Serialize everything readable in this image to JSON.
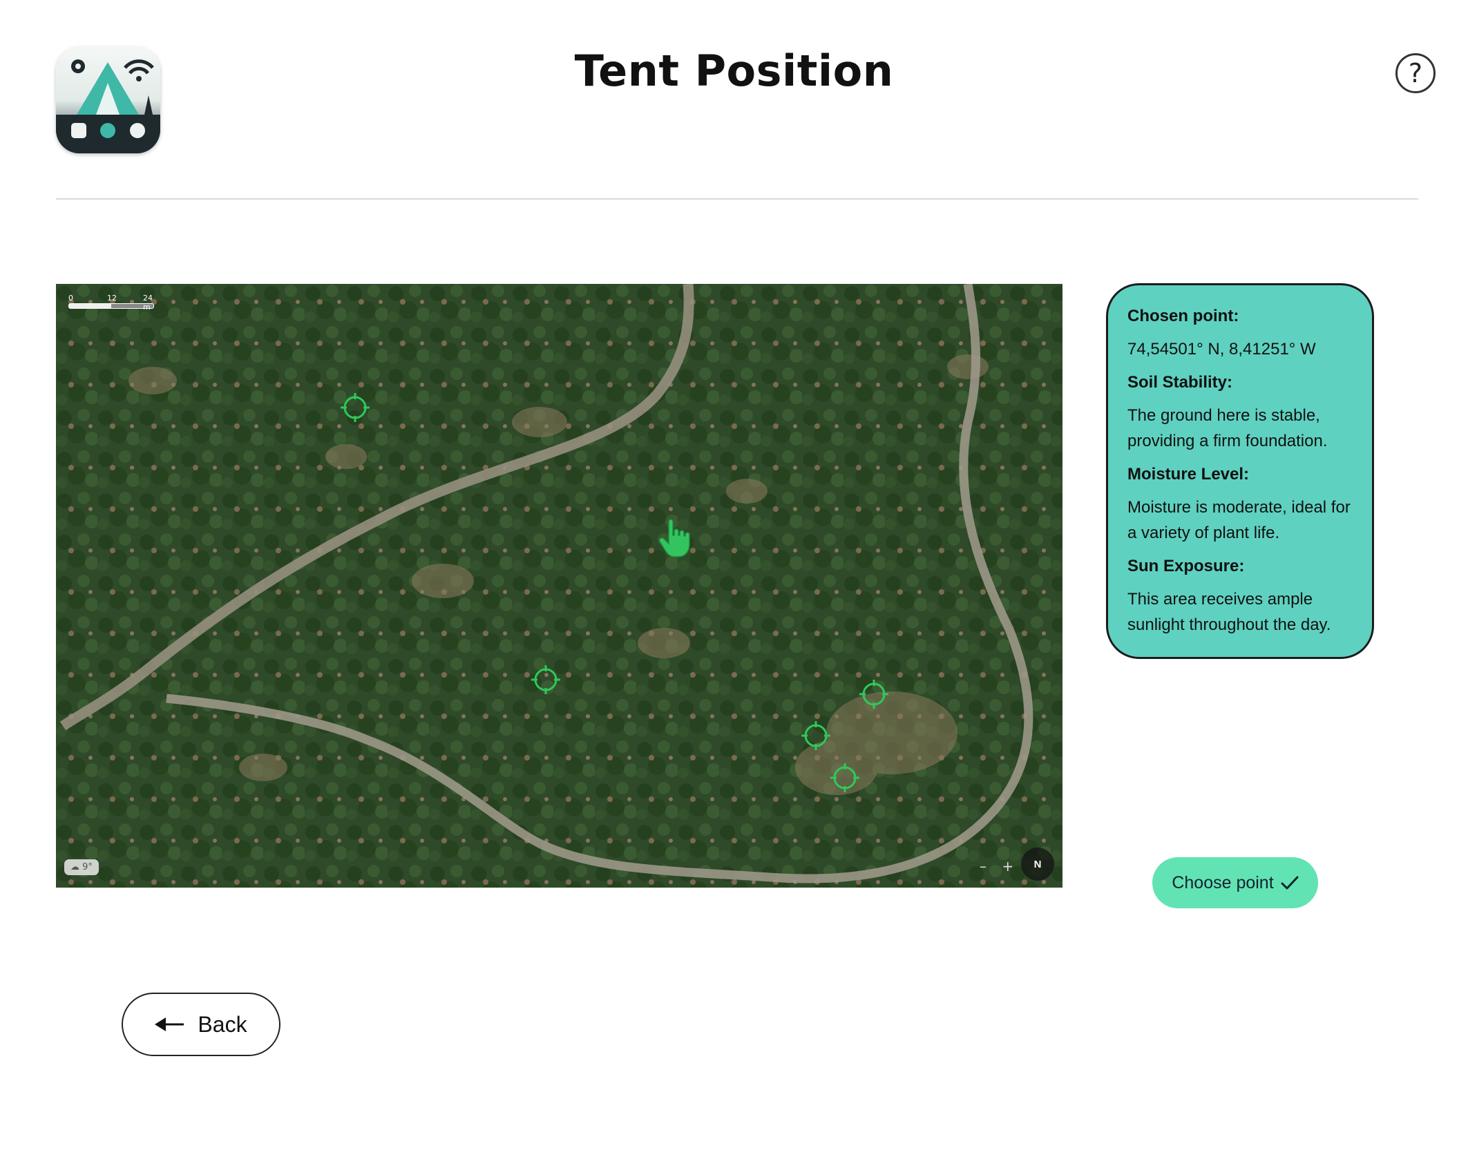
{
  "header": {
    "title": "Tent Position",
    "help_label": "?"
  },
  "map": {
    "scale_labels": [
      "0",
      "12",
      "24 m"
    ],
    "weather": "9°",
    "zoom_out": "–",
    "zoom_in": "+",
    "compass": "N"
  },
  "info": {
    "chosen_point_heading": "Chosen point:",
    "chosen_point_value": "74,54501° N, 8,41251° W",
    "soil_heading": "Soil Stability:",
    "soil_value": "The ground here is stable, providing a firm foundation.",
    "moisture_heading": "Moisture Level:",
    "moisture_value": "Moisture is moderate, ideal for a variety of plant life.",
    "sun_heading": "Sun Exposure:",
    "sun_value": "This area receives ample sunlight throughout the day."
  },
  "actions": {
    "choose_label": "Choose point",
    "back_label": "Back"
  },
  "colors": {
    "info_panel": "#5fd1c0",
    "choose_button": "#62e3b3",
    "target_marker": "#2fc95a"
  }
}
